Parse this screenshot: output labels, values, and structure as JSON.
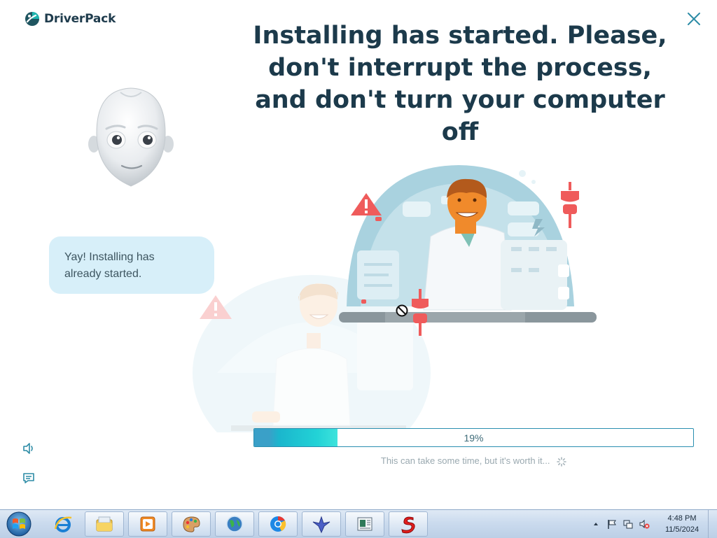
{
  "app": {
    "brand": "DriverPack",
    "headline": "Installing has started. Please, don't interrupt the process, and don't turn your computer off",
    "bubble_lines": [
      "Yay! Installing has",
      "already started."
    ],
    "progress": {
      "value": 0.19,
      "label": "19%"
    },
    "progress_note": "This can take some time, but it's worth it...",
    "icons": [
      "driverpack-logo-icon",
      "close-icon",
      "robot-avatar",
      "sound-icon",
      "chat-icon",
      "no-entry-cursor-icon",
      "spinner-icon"
    ],
    "colors": {
      "accent": "#1bb6cd",
      "headline": "#1c3a4b",
      "bubble": "#d7eff9",
      "alert": "#ef5b5b"
    }
  },
  "taskbar": {
    "pinned": [
      "internet-explorer-icon",
      "file-explorer-icon",
      "media-player-icon",
      "paint-icon",
      "network-globe-icon",
      "chrome-like-icon",
      "bird-app-icon",
      "document-viewer-icon",
      "red-s-app-icon"
    ],
    "tray": [
      "show-hidden-icons-icon",
      "action-center-flag-icon",
      "network-icon",
      "volume-muted-icon"
    ],
    "clock_time": "4:48 PM",
    "clock_date": "11/5/2024"
  }
}
